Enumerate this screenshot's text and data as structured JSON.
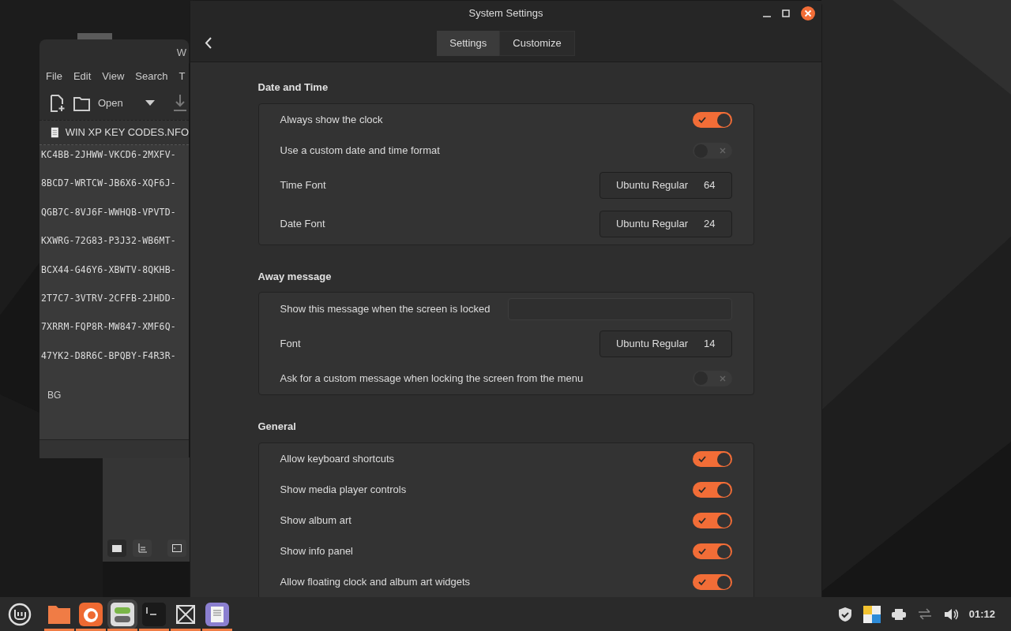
{
  "editor": {
    "title": "W",
    "menu": [
      "File",
      "Edit",
      "View",
      "Search",
      "T"
    ],
    "toolbar": {
      "open_label": "Open"
    },
    "tab": "WIN XP KEY CODES.NFO",
    "lines": [
      "KC4BB-2JHWW-VKCD6-2MXFV-",
      "8BCD7-WRTCW-JB6X6-XQF6J-",
      "QGB7C-8VJ6F-WWHQB-VPVTD-",
      "KXWRG-72G83-P3J32-WB6MT-",
      "BCX44-G46Y6-XBWTV-8QKHB-",
      "2T7C7-3VTRV-2CFFB-2JHDD-",
      "7XRRM-FQP8R-MW847-XMF6Q-",
      "47YK2-D8R6C-BPQBY-F4R3R-"
    ],
    "footer_text": "BG"
  },
  "settings": {
    "title": "System Settings",
    "tabs": [
      {
        "label": "Settings",
        "selected": false
      },
      {
        "label": "Customize",
        "selected": true
      }
    ],
    "sections": [
      {
        "title": "Date and Time",
        "rows": [
          {
            "kind": "switch",
            "label": "Always show the clock",
            "on": true
          },
          {
            "kind": "switch",
            "label": "Use a custom date and time format",
            "on": false
          },
          {
            "kind": "font",
            "label": "Time Font",
            "font": "Ubuntu Regular",
            "size": "64"
          },
          {
            "kind": "font",
            "label": "Date Font",
            "font": "Ubuntu Regular",
            "size": "24"
          }
        ]
      },
      {
        "title": "Away message",
        "rows": [
          {
            "kind": "entry",
            "label": "Show this message when the screen is locked"
          },
          {
            "kind": "font",
            "label": "Font",
            "font": "Ubuntu Regular",
            "size": "14"
          },
          {
            "kind": "switch",
            "label": "Ask for a custom message when locking the screen from the menu",
            "on": false
          }
        ]
      },
      {
        "title": "General",
        "rows": [
          {
            "kind": "switch",
            "label": "Allow keyboard shortcuts",
            "on": true
          },
          {
            "kind": "switch",
            "label": "Show media player controls",
            "on": true
          },
          {
            "kind": "switch",
            "label": "Show album art",
            "on": true
          },
          {
            "kind": "switch",
            "label": "Show info panel",
            "on": true
          },
          {
            "kind": "switch",
            "label": "Allow floating clock and album art widgets",
            "on": true
          }
        ]
      }
    ]
  },
  "taskbar": {
    "clock": "01:12"
  }
}
